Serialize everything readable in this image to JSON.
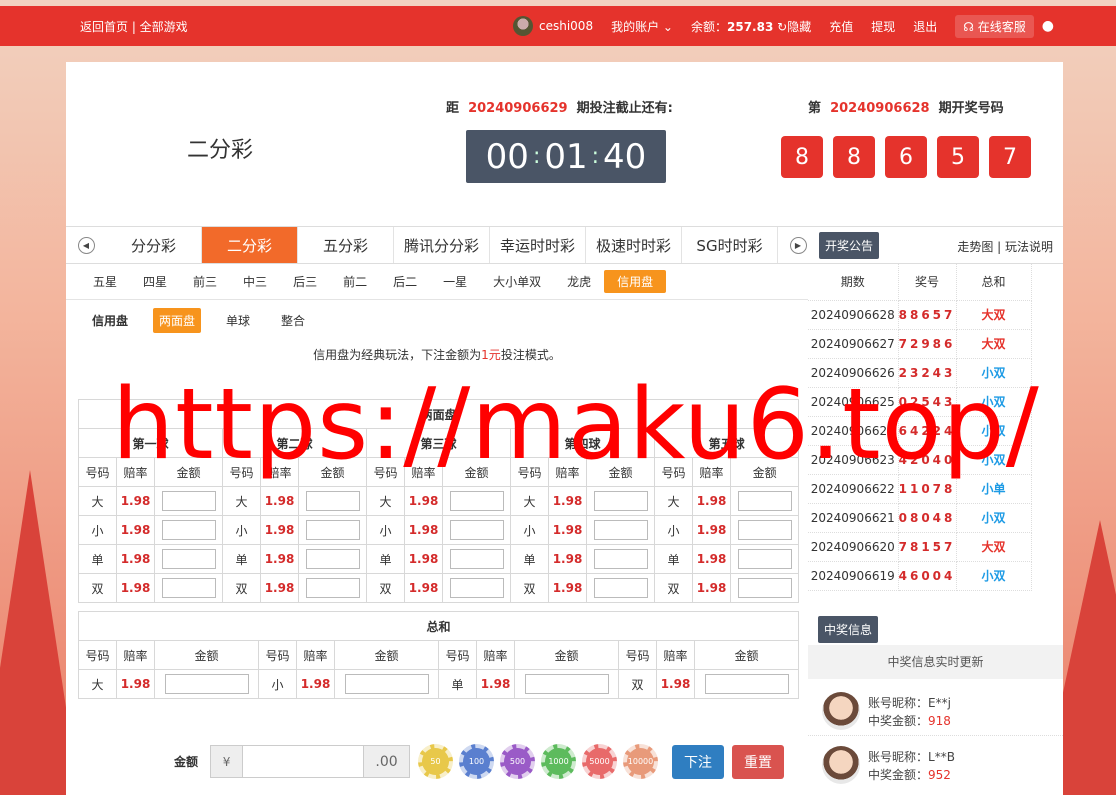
{
  "topbar": {
    "home_link": "返回首页 | 全部游戏",
    "username": "ceshi008",
    "account": "我的账户",
    "balance_label": "余额：",
    "balance": "257.83",
    "hide": "隐藏",
    "recharge": "充值",
    "withdraw": "提现",
    "logout": "退出",
    "service": "在线客服"
  },
  "header": {
    "game_name": "二分彩",
    "countdown_prefix": "距",
    "countdown_issue": "20240906629",
    "countdown_suffix": "期投注截止还有:",
    "clock": {
      "h": "00",
      "m": "01",
      "s": "40"
    },
    "draw_prefix": "第",
    "draw_issue": "20240906628",
    "draw_suffix": "期开奖号码",
    "draw_numbers": [
      "8",
      "8",
      "6",
      "5",
      "7"
    ]
  },
  "game_tabs": [
    "分分彩",
    "二分彩",
    "五分彩",
    "腾讯分分彩",
    "幸运时时彩",
    "极速时时彩",
    "SG时时彩"
  ],
  "notice_button": "开奖公告",
  "trend_links": "走势图 | 玩法说明",
  "sub_tabs": [
    "五星",
    "四星",
    "前三",
    "中三",
    "后三",
    "前二",
    "后二",
    "一星",
    "大小单双",
    "龙虎",
    "信用盘"
  ],
  "modes": [
    "信用盘",
    "两面盘",
    "单球",
    "整合"
  ],
  "desc": {
    "before": "信用盘为经典玩法，下注金额为",
    "red": "1元",
    "after": "投注模式。"
  },
  "bet_table": {
    "title": "两面盘",
    "balls": [
      "第一球",
      "第二球",
      "第三球",
      "第四球",
      "第五球"
    ],
    "col_headers": [
      "号码",
      "赔率",
      "金额"
    ],
    "rows": [
      {
        "code": "大",
        "odds": "1.98"
      },
      {
        "code": "小",
        "odds": "1.98"
      },
      {
        "code": "单",
        "odds": "1.98"
      },
      {
        "code": "双",
        "odds": "1.98"
      }
    ]
  },
  "sum_table": {
    "title": "总和",
    "col_headers": [
      "号码",
      "赔率",
      "金额"
    ],
    "items": [
      {
        "code": "大",
        "odds": "1.98"
      },
      {
        "code": "小",
        "odds": "1.98"
      },
      {
        "code": "单",
        "odds": "1.98"
      },
      {
        "code": "双",
        "odds": "1.98"
      }
    ]
  },
  "footer": {
    "amount_label": "金额",
    "currency": "¥",
    "decimal": ".00",
    "chips": [
      "50",
      "100",
      "500",
      "1000",
      "5000",
      "10000"
    ],
    "chip_colors": [
      "#e8c84a",
      "#5a7fcf",
      "#9a5bc7",
      "#5dbb5d",
      "#e86a6a",
      "#e89a7a"
    ],
    "bet_button": "下注",
    "reset_button": "重置"
  },
  "history": {
    "headers": [
      "期数",
      "奖号",
      "总和"
    ],
    "rows": [
      {
        "issue": "20240906628",
        "nums": "88657",
        "sum": "大双",
        "type": "big"
      },
      {
        "issue": "20240906627",
        "nums": "72986",
        "sum": "大双",
        "type": "big"
      },
      {
        "issue": "20240906626",
        "nums": "23243",
        "sum": "小双",
        "type": "small"
      },
      {
        "issue": "20240906625",
        "nums": "02543",
        "sum": "小双",
        "type": "small"
      },
      {
        "issue": "20240906624",
        "nums": "64224",
        "sum": "小双",
        "type": "small"
      },
      {
        "issue": "20240906623",
        "nums": "42040",
        "sum": "小双",
        "type": "small"
      },
      {
        "issue": "20240906622",
        "nums": "11078",
        "sum": "小单",
        "type": "small"
      },
      {
        "issue": "20240906621",
        "nums": "08048",
        "sum": "小双",
        "type": "small"
      },
      {
        "issue": "20240906620",
        "nums": "78157",
        "sum": "大双",
        "type": "big"
      },
      {
        "issue": "20240906619",
        "nums": "46004",
        "sum": "小双",
        "type": "small"
      }
    ]
  },
  "win_info": {
    "button": "中奖信息",
    "live": "中奖信息实时更新",
    "entries": [
      {
        "nick_label": "账号昵称：",
        "nick": "E**j",
        "amount_label": "中奖金额：",
        "amount": "918"
      },
      {
        "nick_label": "账号昵称：",
        "nick": "L**B",
        "amount_label": "中奖金额：",
        "amount": "952"
      }
    ]
  },
  "watermark": "https://maku6.top/"
}
